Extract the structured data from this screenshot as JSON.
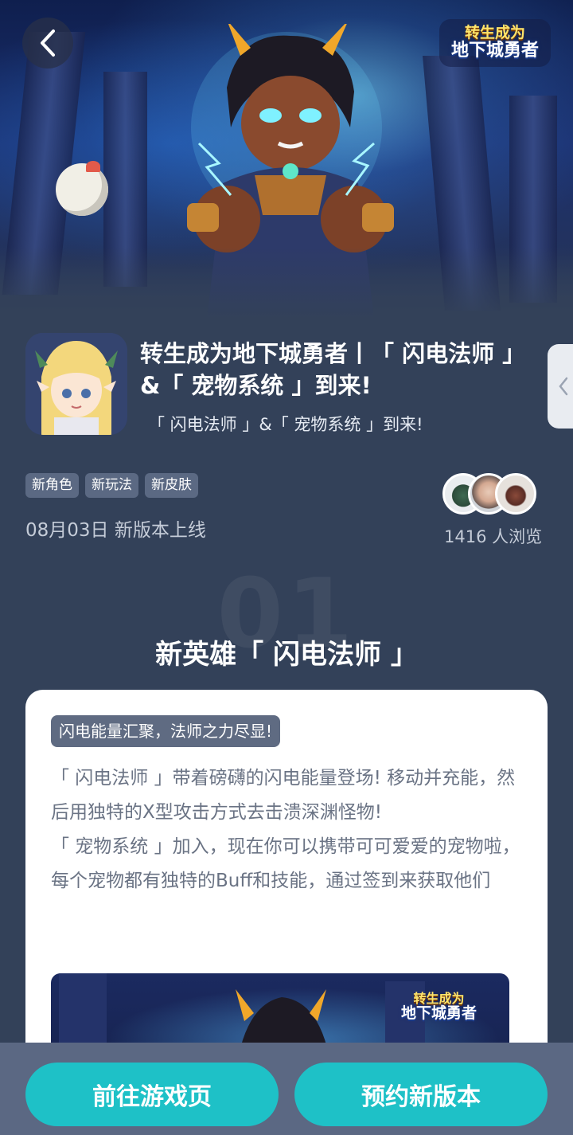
{
  "hero": {
    "logo_line1": "转生成为",
    "logo_line2": "地下城勇者"
  },
  "app": {
    "title": "转生成为地下城勇者丨「 闪电法师 」&「 宠物系统 」到来!",
    "subtitle": "「 闪电法师 」&「 宠物系统 」到来!"
  },
  "tags": [
    "新角色",
    "新玩法",
    "新皮肤"
  ],
  "release": "08月03日 新版本上线",
  "views": "1416 人浏览",
  "section": {
    "number": "01",
    "title": "新英雄「 闪电法师 」"
  },
  "card": {
    "tag": "闪电能量汇聚，法师之力尽显!",
    "paragraph1": "「 闪电法师 」带着磅礴的闪电能量登场! 移动并充能，然后用独特的X型攻击方式去击溃深渊怪物!",
    "paragraph2": "「 宠物系统 」加入，现在你可以携带可可爱爱的宠物啦，每个宠物都有独特的Buff和技能，通过签到来获取他们",
    "image_logo_line1": "转生成为",
    "image_logo_line2": "地下城勇者"
  },
  "buttons": {
    "goto_game": "前往游戏页",
    "reserve": "预约新版本"
  },
  "colors": {
    "background": "#334159",
    "accent": "#1ec1c7",
    "tag_bg": "#5b6983"
  }
}
